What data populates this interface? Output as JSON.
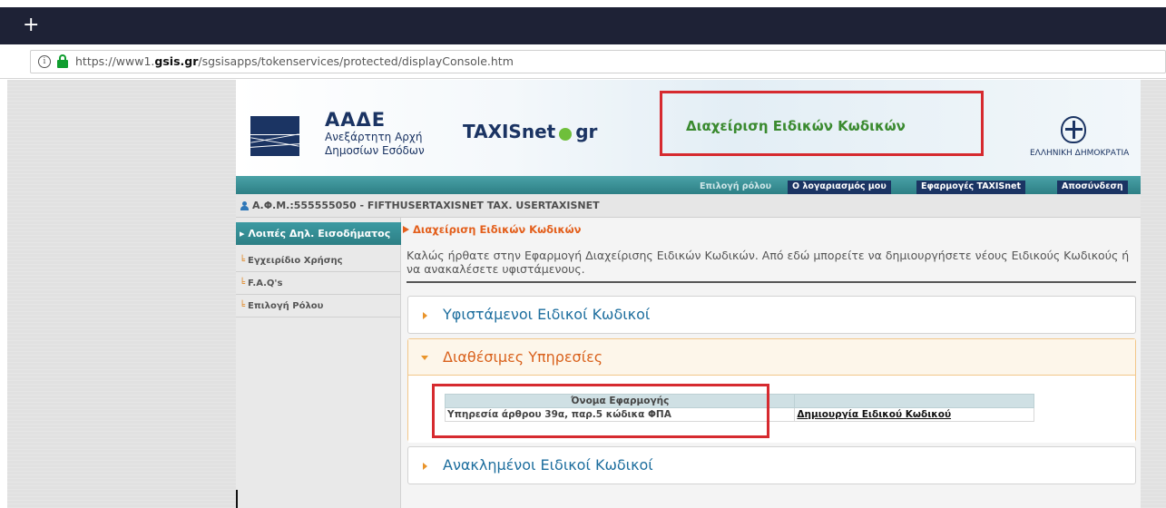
{
  "browser": {
    "new_tab_symbol": "+",
    "url_prefix": "https://www1.",
    "url_domain": "gsis.gr",
    "url_path": "/sgsisapps/tokenservices/protected/displayConsole.htm"
  },
  "header": {
    "aade_title": "ΑΑΔΕ",
    "aade_sub1": "Ανεξάρτητη Αρχή",
    "aade_sub2": "Δημοσίων Εσόδων",
    "taxis_left": "TAXISnet",
    "taxis_right": "gr",
    "page_heading": "Διαχείριση Ειδικών Κωδικών",
    "hellenic_republic": "ΕΛΛΗΝΙΚΗ ΔΗΜΟΚΡΑΤΙΑ"
  },
  "nav": {
    "role_select": "Επιλογή ρόλου",
    "my_account": "Ο λογαριασμός μου",
    "taxisnet_apps": "Εφαρμογές TAXISnet",
    "logout": "Αποσύνδεση"
  },
  "user": {
    "afm_text": "Α.Φ.Μ.:555555050 - FIFTHUSERTAXISNET TAX. USERTAXISNET"
  },
  "sidebar": {
    "active_item": "▸ Λοιπές Δηλ. Εισοδήματος",
    "items": [
      {
        "label": "Εγχειρίδιο Χρήσης"
      },
      {
        "label": "F.A.Q's"
      },
      {
        "label": "Επιλογή Ρόλου"
      }
    ]
  },
  "content": {
    "breadcrumb": "Διαχείριση Ειδικών Κωδικών",
    "welcome": "Καλώς ήρθατε στην Εφαρμογή Διαχείρισης Ειδικών Κωδικών. Από εδώ μπορείτε να δημιουργήσετε νέους Ειδικούς Κωδικούς ή να ανακαλέσετε υφιστάμενους.",
    "panels": {
      "existing": "Υφιστάμενοι Ειδικοί Κωδικοί",
      "available": "Διαθέσιμες Υπηρεσίες",
      "revoked": "Ανακλημένοι Ειδικοί Κωδικοί"
    },
    "table": {
      "header": "Όνομα Εφαρμογής",
      "row_service": "Υπηρεσία άρθρου 39α, παρ.5 κώδικα ΦΠΑ",
      "row_action": "Δημιουργία Ειδικού Κωδικού"
    }
  },
  "colors": {
    "accent_red_box": "#d62a2f",
    "heading_green": "#3a8a2f",
    "teal_nav": "#2d7f85",
    "navy": "#1b3463",
    "orange": "#e35f1c"
  }
}
